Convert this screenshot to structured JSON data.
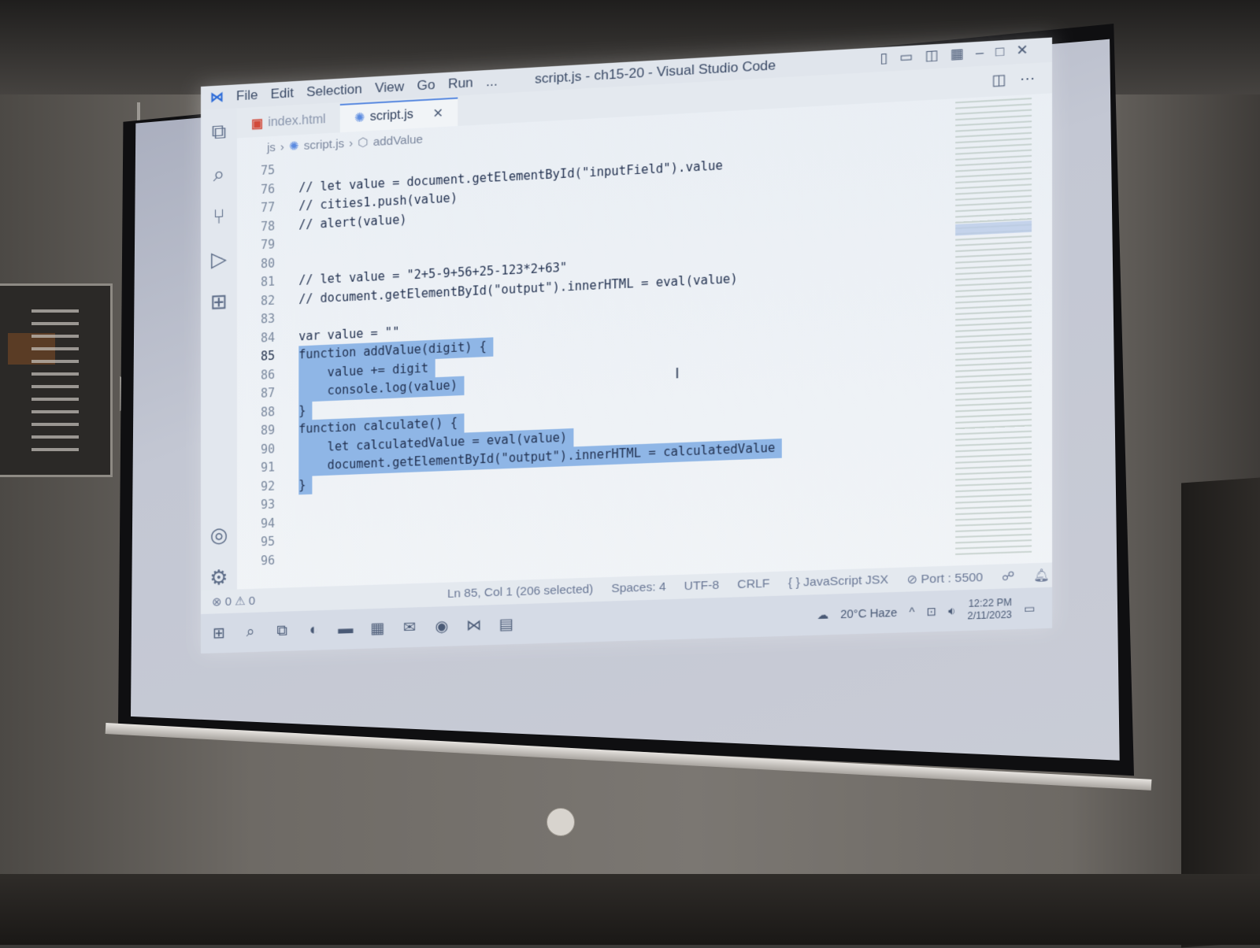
{
  "window": {
    "title": "script.js - ch15-20 - Visual Studio Code",
    "menu": [
      "File",
      "Edit",
      "Selection",
      "View",
      "Go",
      "Run",
      "..."
    ]
  },
  "tabs": [
    {
      "label": "index.html",
      "icon": "html5-icon",
      "active": false
    },
    {
      "label": "script.js",
      "icon": "js-file-icon",
      "active": true
    }
  ],
  "breadcrumb": [
    "js",
    "script.js",
    "addValue"
  ],
  "code_lines": [
    {
      "n": "75",
      "text": "",
      "selected": false
    },
    {
      "n": "76",
      "text": "// let value = document.getElementById(\"inputField\").value",
      "selected": false
    },
    {
      "n": "77",
      "text": "// cities1.push(value)",
      "selected": false
    },
    {
      "n": "78",
      "text": "// alert(value)",
      "selected": false
    },
    {
      "n": "79",
      "text": "",
      "selected": false
    },
    {
      "n": "80",
      "text": "",
      "selected": false
    },
    {
      "n": "81",
      "text": "// let value = \"2+5-9+56+25-123*2+63\"",
      "selected": false
    },
    {
      "n": "82",
      "text": "// document.getElementById(\"output\").innerHTML = eval(value)",
      "selected": false
    },
    {
      "n": "83",
      "text": "",
      "selected": false
    },
    {
      "n": "84",
      "text": "var value = \"\"",
      "selected": false
    },
    {
      "n": "85",
      "text": "function addValue(digit) {",
      "selected": true
    },
    {
      "n": "86",
      "text": "    value += digit",
      "selected": true
    },
    {
      "n": "87",
      "text": "    console.log(value)",
      "selected": true
    },
    {
      "n": "88",
      "text": "}",
      "selected": true
    },
    {
      "n": "89",
      "text": "function calculate() {",
      "selected": true
    },
    {
      "n": "90",
      "text": "    let calculatedValue = eval(value)",
      "selected": true
    },
    {
      "n": "91",
      "text": "    document.getElementById(\"output\").innerHTML = calculatedValue",
      "selected": true
    },
    {
      "n": "92",
      "text": "}",
      "selected": true
    },
    {
      "n": "93",
      "text": "",
      "selected": false
    },
    {
      "n": "94",
      "text": "",
      "selected": false
    },
    {
      "n": "95",
      "text": "",
      "selected": false
    },
    {
      "n": "96",
      "text": "",
      "selected": false
    }
  ],
  "current_line": "85",
  "status": {
    "problems": "⊗ 0 ⚠ 0",
    "position": "Ln 85, Col 1 (206 selected)",
    "spaces": "Spaces: 4",
    "encoding": "UTF-8",
    "eol": "CRLF",
    "language": "{ } JavaScript JSX",
    "port": "⊘ Port : 5500"
  },
  "taskbar": {
    "weather": "20°C  Haze",
    "time": "12:22 PM",
    "date": "2/11/2023"
  },
  "colors": {
    "selection": "#8fb6e6",
    "accent": "#2a6ad8"
  }
}
